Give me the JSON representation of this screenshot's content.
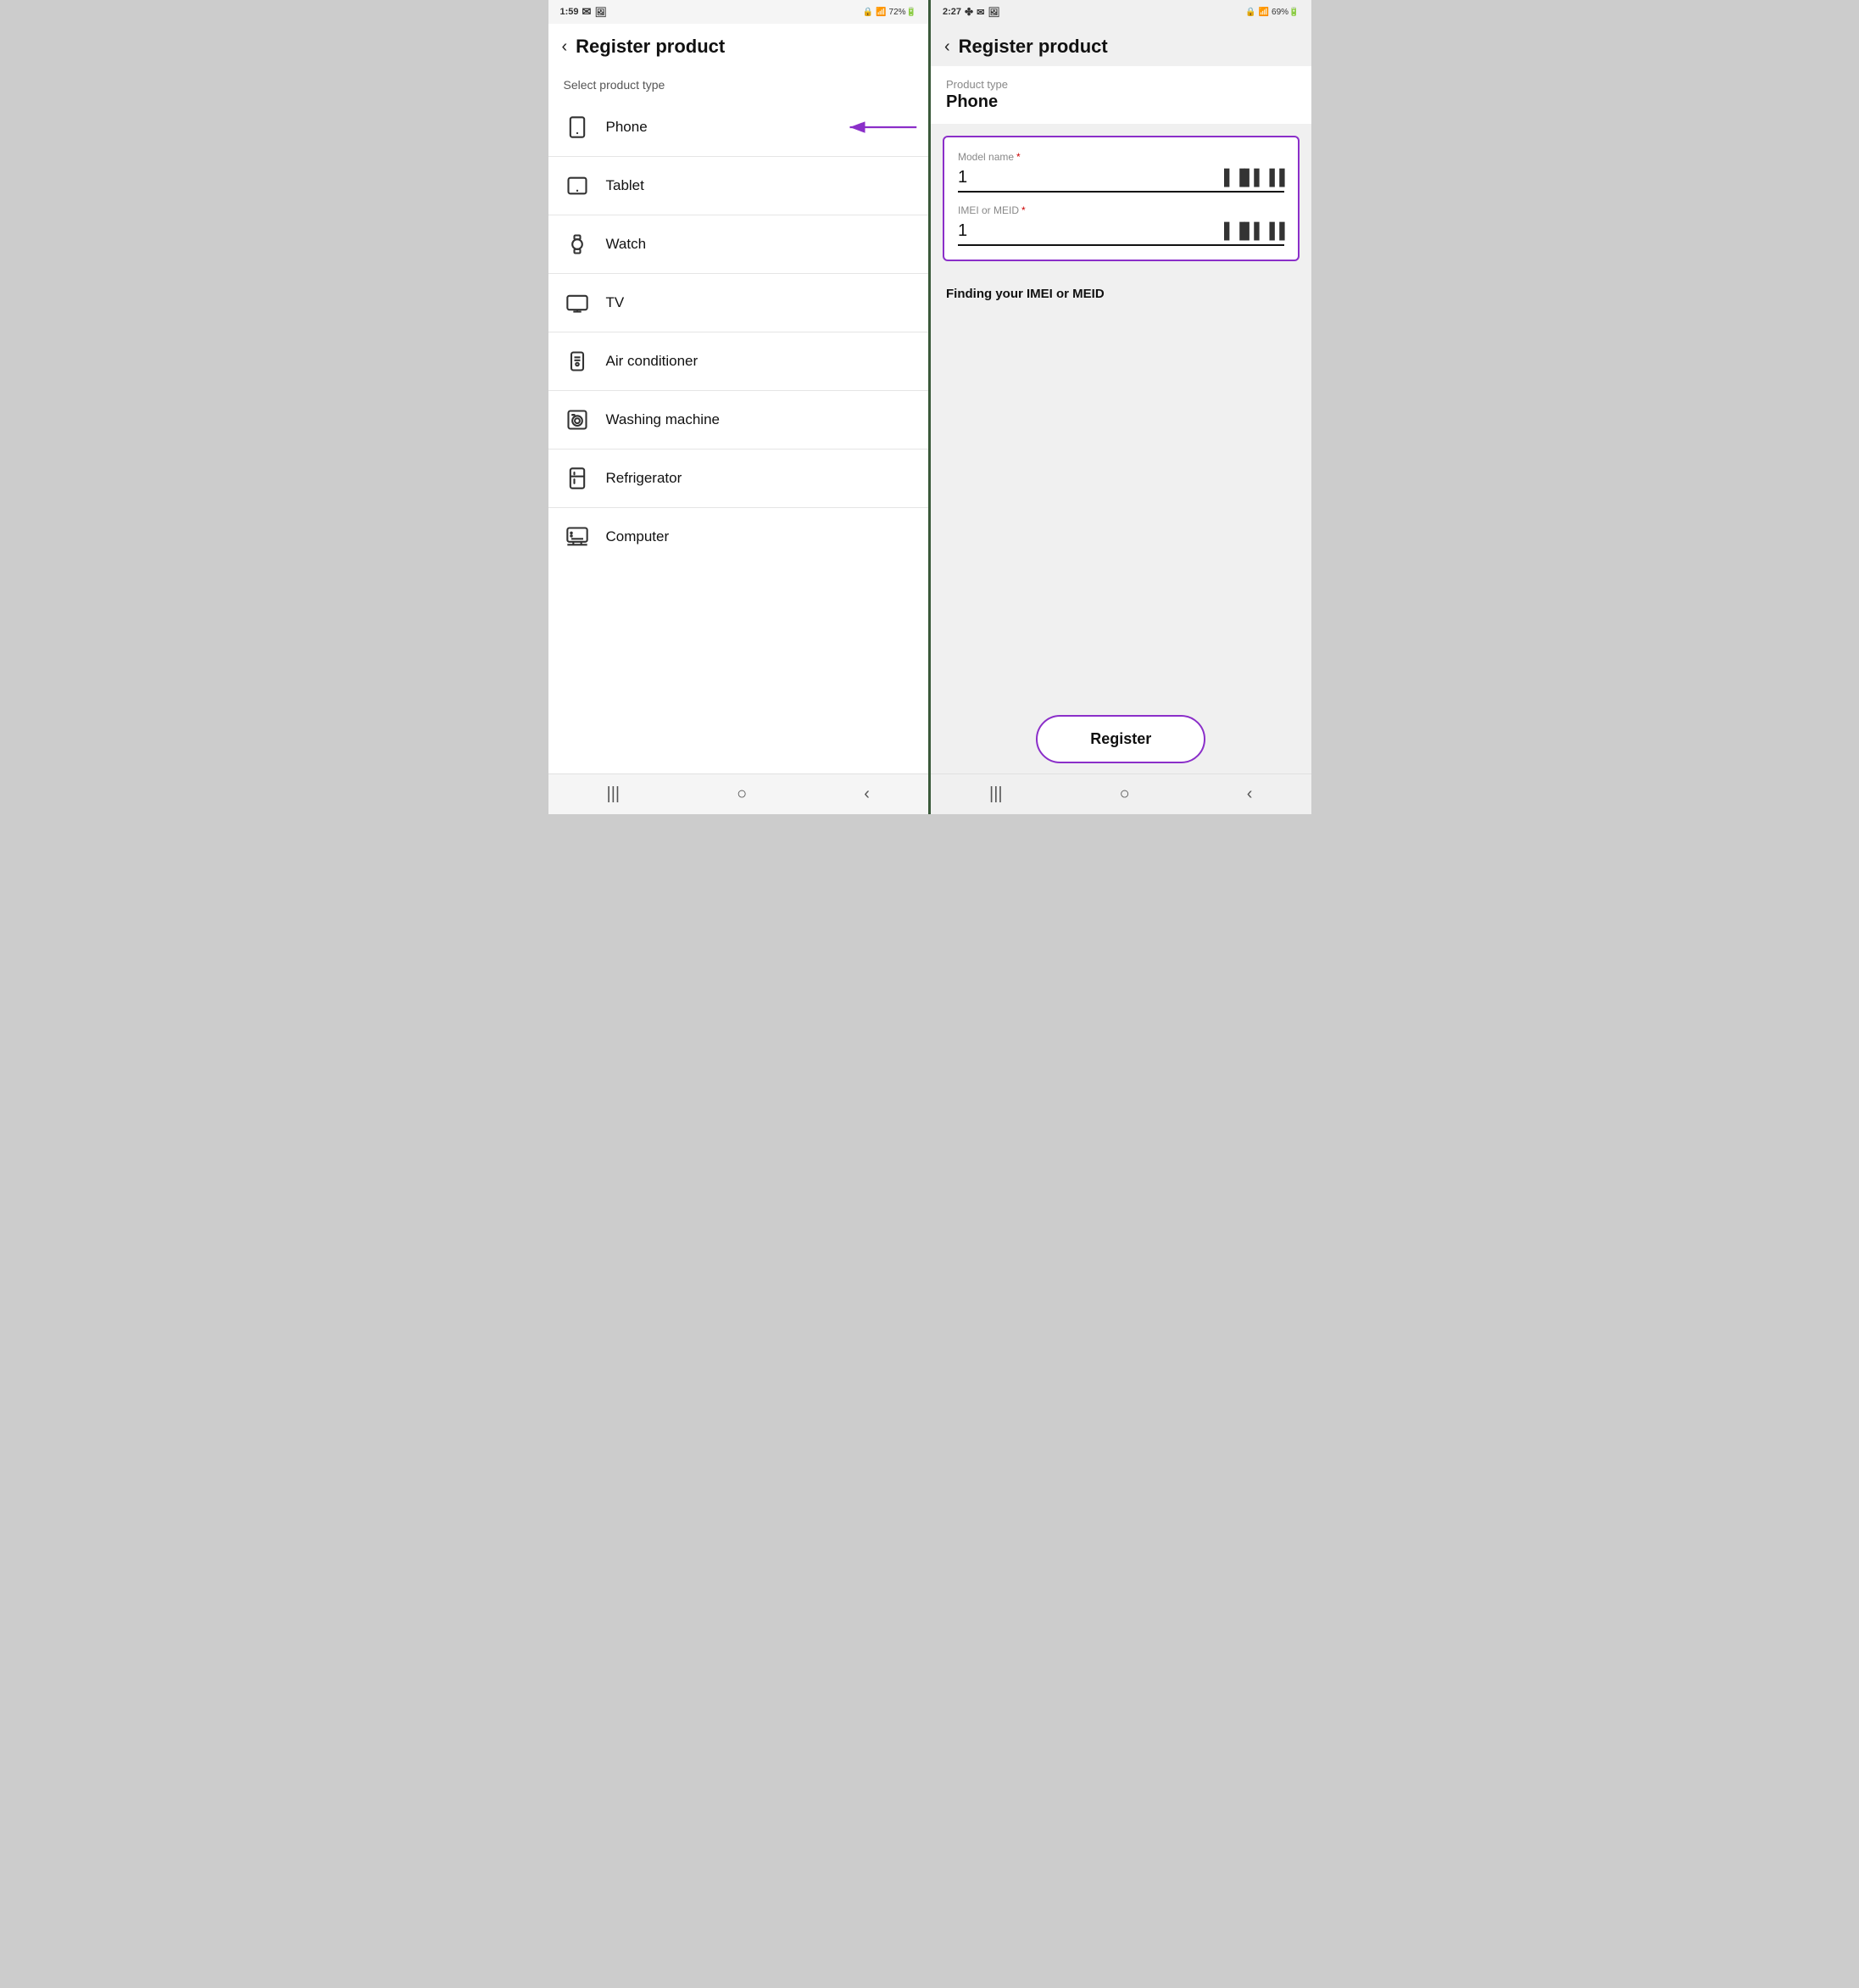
{
  "left_screen": {
    "status_time": "1:59",
    "status_icons": "M 📷 🔒 📶 72%🔋",
    "header": {
      "back_label": "‹",
      "title": "Register product"
    },
    "section_label": "Select product type",
    "product_items": [
      {
        "id": "phone",
        "name": "Phone",
        "icon": "phone",
        "has_arrow": true
      },
      {
        "id": "tablet",
        "name": "Tablet",
        "icon": "tablet",
        "has_arrow": false
      },
      {
        "id": "watch",
        "name": "Watch",
        "icon": "watch",
        "has_arrow": false
      },
      {
        "id": "tv",
        "name": "TV",
        "icon": "tv",
        "has_arrow": false
      },
      {
        "id": "air-conditioner",
        "name": "Air conditioner",
        "icon": "ac",
        "has_arrow": false
      },
      {
        "id": "washing-machine",
        "name": "Washing machine",
        "icon": "washer",
        "has_arrow": false
      },
      {
        "id": "refrigerator",
        "name": "Refrigerator",
        "icon": "fridge",
        "has_arrow": false
      },
      {
        "id": "computer",
        "name": "Computer",
        "icon": "computer",
        "has_arrow": false
      }
    ],
    "nav": [
      "|||",
      "○",
      "‹"
    ]
  },
  "right_screen": {
    "status_time": "2:27",
    "header": {
      "back_label": "‹",
      "title": "Register product"
    },
    "product_type_label": "Product type",
    "product_type_value": "Phone",
    "form": {
      "model_name_label": "Model name",
      "model_name_value": "1",
      "imei_label": "IMEI or MEID",
      "imei_value": "1"
    },
    "finding_link": "Finding your IMEI or MEID",
    "register_btn": "Register",
    "nav": [
      "|||",
      "○",
      "‹"
    ]
  }
}
